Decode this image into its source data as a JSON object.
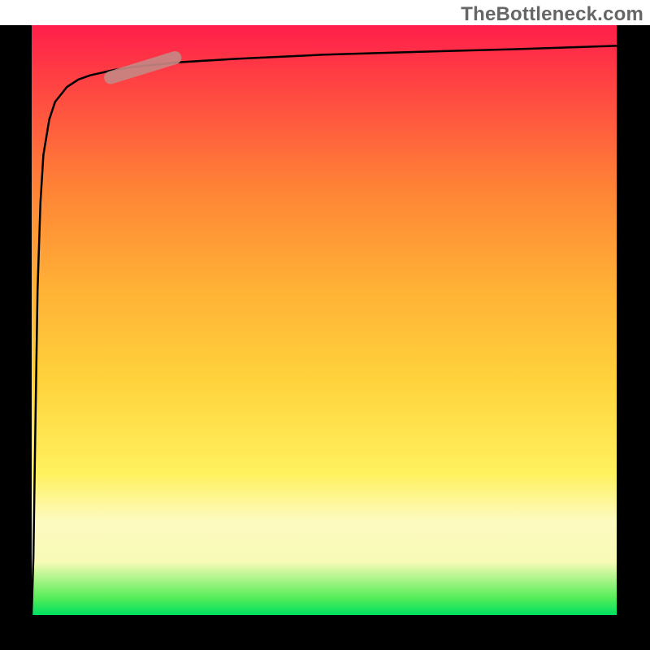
{
  "watermark": "TheBottleneck.com",
  "chart_data": {
    "type": "line",
    "title": "",
    "xlabel": "",
    "ylabel": "",
    "xlim": [
      0,
      100
    ],
    "ylim": [
      0,
      100
    ],
    "grid": false,
    "background_gradient": {
      "stops": [
        {
          "offset": 0.0,
          "color": "#00e060"
        },
        {
          "offset": 0.03,
          "color": "#58ed5a"
        },
        {
          "offset": 0.09,
          "color": "#f7fbb6"
        },
        {
          "offset": 0.16,
          "color": "#fdfac0"
        },
        {
          "offset": 0.24,
          "color": "#fff15e"
        },
        {
          "offset": 0.4,
          "color": "#ffd23c"
        },
        {
          "offset": 0.55,
          "color": "#ffb236"
        },
        {
          "offset": 0.72,
          "color": "#ff8436"
        },
        {
          "offset": 0.86,
          "color": "#ff5240"
        },
        {
          "offset": 1.0,
          "color": "#ff1e4a"
        }
      ]
    },
    "curve": {
      "x": [
        0,
        0.3,
        0.6,
        1,
        1.5,
        2,
        3,
        4,
        6,
        8,
        10,
        14,
        18,
        25,
        35,
        50,
        70,
        85,
        100
      ],
      "y": [
        0,
        10,
        30,
        55,
        70,
        78,
        84,
        87,
        89.5,
        90.8,
        91.5,
        92.4,
        93,
        93.7,
        94.3,
        95,
        95.6,
        96,
        96.5
      ]
    },
    "highlight": {
      "center_x": 19,
      "center_y": 92.8,
      "half_length": 5.5,
      "angle_deg": 17,
      "color": "#c78683",
      "thickness_px": 16
    }
  }
}
